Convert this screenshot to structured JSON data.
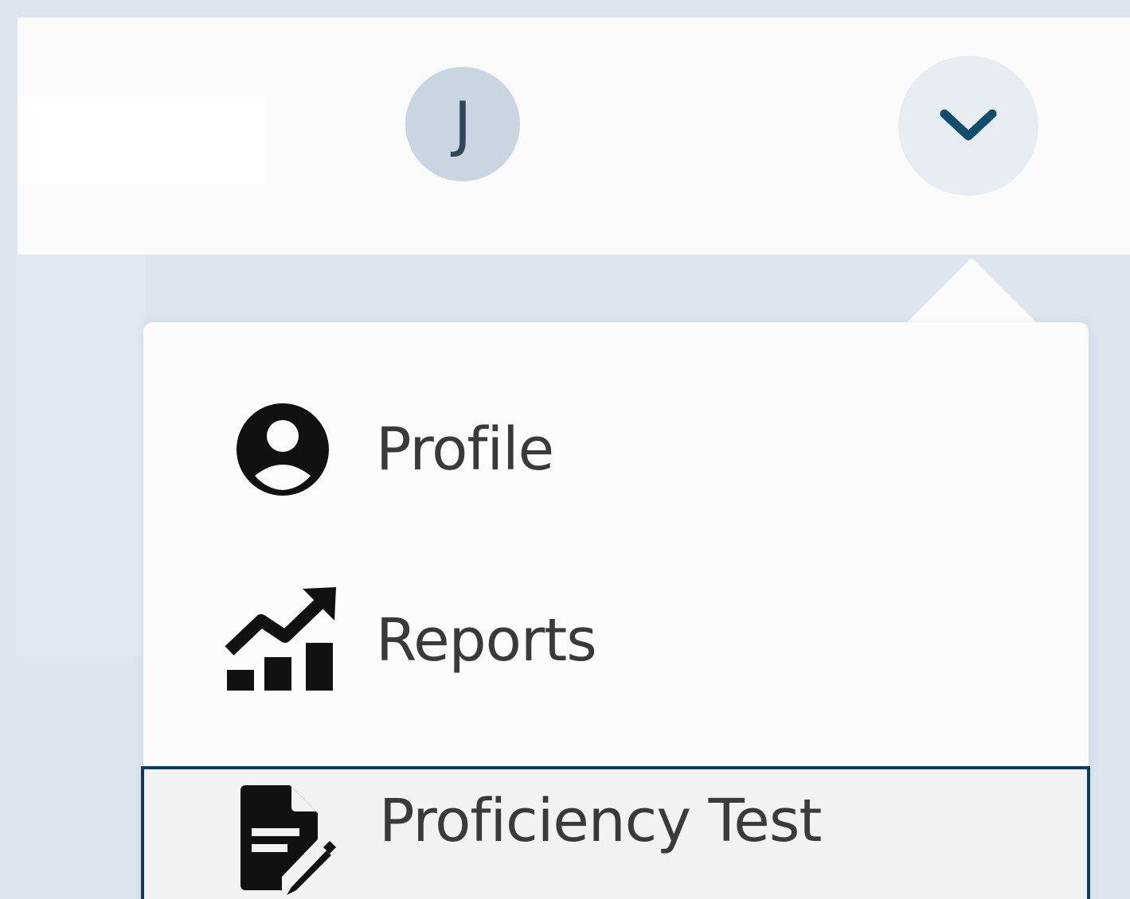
{
  "header": {
    "avatar_initial": "J",
    "dropdown_icon": "chevron-down-icon"
  },
  "menu": {
    "items": [
      {
        "label": "Profile",
        "icon": "user-circle-icon"
      },
      {
        "label": "Reports",
        "icon": "chart-line-icon"
      },
      {
        "label": "Proficiency Test",
        "icon": "file-signature-icon",
        "focused": true
      }
    ]
  },
  "colors": {
    "page_bg": "#dde6ee",
    "avatar_bg": "#c9d6e2",
    "avatar_text": "#2f4858",
    "chevron": "#0f4c6e",
    "focus_border": "#0f3d57",
    "item_text": "#3a3a3a"
  }
}
